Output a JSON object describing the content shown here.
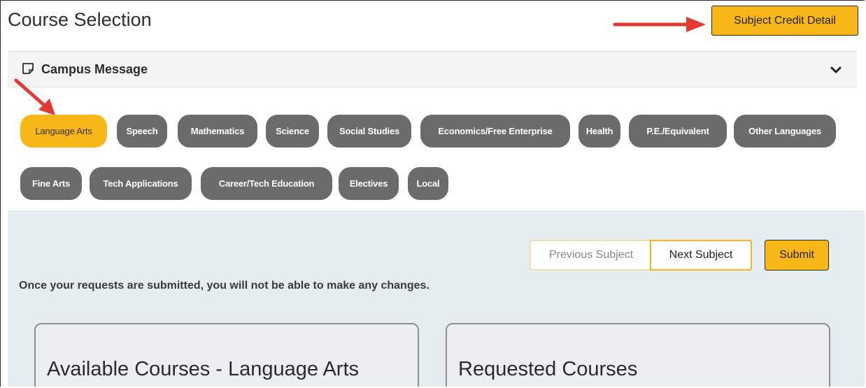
{
  "page": {
    "title": "Course Selection",
    "subject_credit_label": "Subject Credit Detail"
  },
  "campus_message": {
    "title": "Campus Message",
    "icon": "note-icon",
    "toggle_icon": "chevron-down-icon"
  },
  "subjects": [
    {
      "label": "Language Arts",
      "active": true
    },
    {
      "label": "Speech",
      "active": false
    },
    {
      "label": "Mathematics",
      "active": false
    },
    {
      "label": "Science",
      "active": false
    },
    {
      "label": "Social Studies",
      "active": false
    },
    {
      "label": "Economics/Free Enterprise",
      "active": false
    },
    {
      "label": "Health",
      "active": false
    },
    {
      "label": "P.E./Equivalent",
      "active": false
    },
    {
      "label": "Other Languages",
      "active": false
    },
    {
      "label": "Fine Arts",
      "active": false
    },
    {
      "label": "Tech Applications",
      "active": false
    },
    {
      "label": "Career/Tech Education",
      "active": false
    },
    {
      "label": "Electives",
      "active": false
    },
    {
      "label": "Local",
      "active": false
    }
  ],
  "navigation": {
    "previous_label": "Previous Subject",
    "next_label": "Next Subject",
    "submit_label": "Submit"
  },
  "notice": "Once your requests are submitted, you will not be able to make any changes.",
  "panels": {
    "available_title": "Available Courses - Language Arts",
    "requested_title": "Requested Courses"
  },
  "colors": {
    "accent": "#f8b719",
    "pill_inactive": "#6b6b6b",
    "annotation_arrow": "#e23b33",
    "section_bg": "#e6edf0"
  }
}
